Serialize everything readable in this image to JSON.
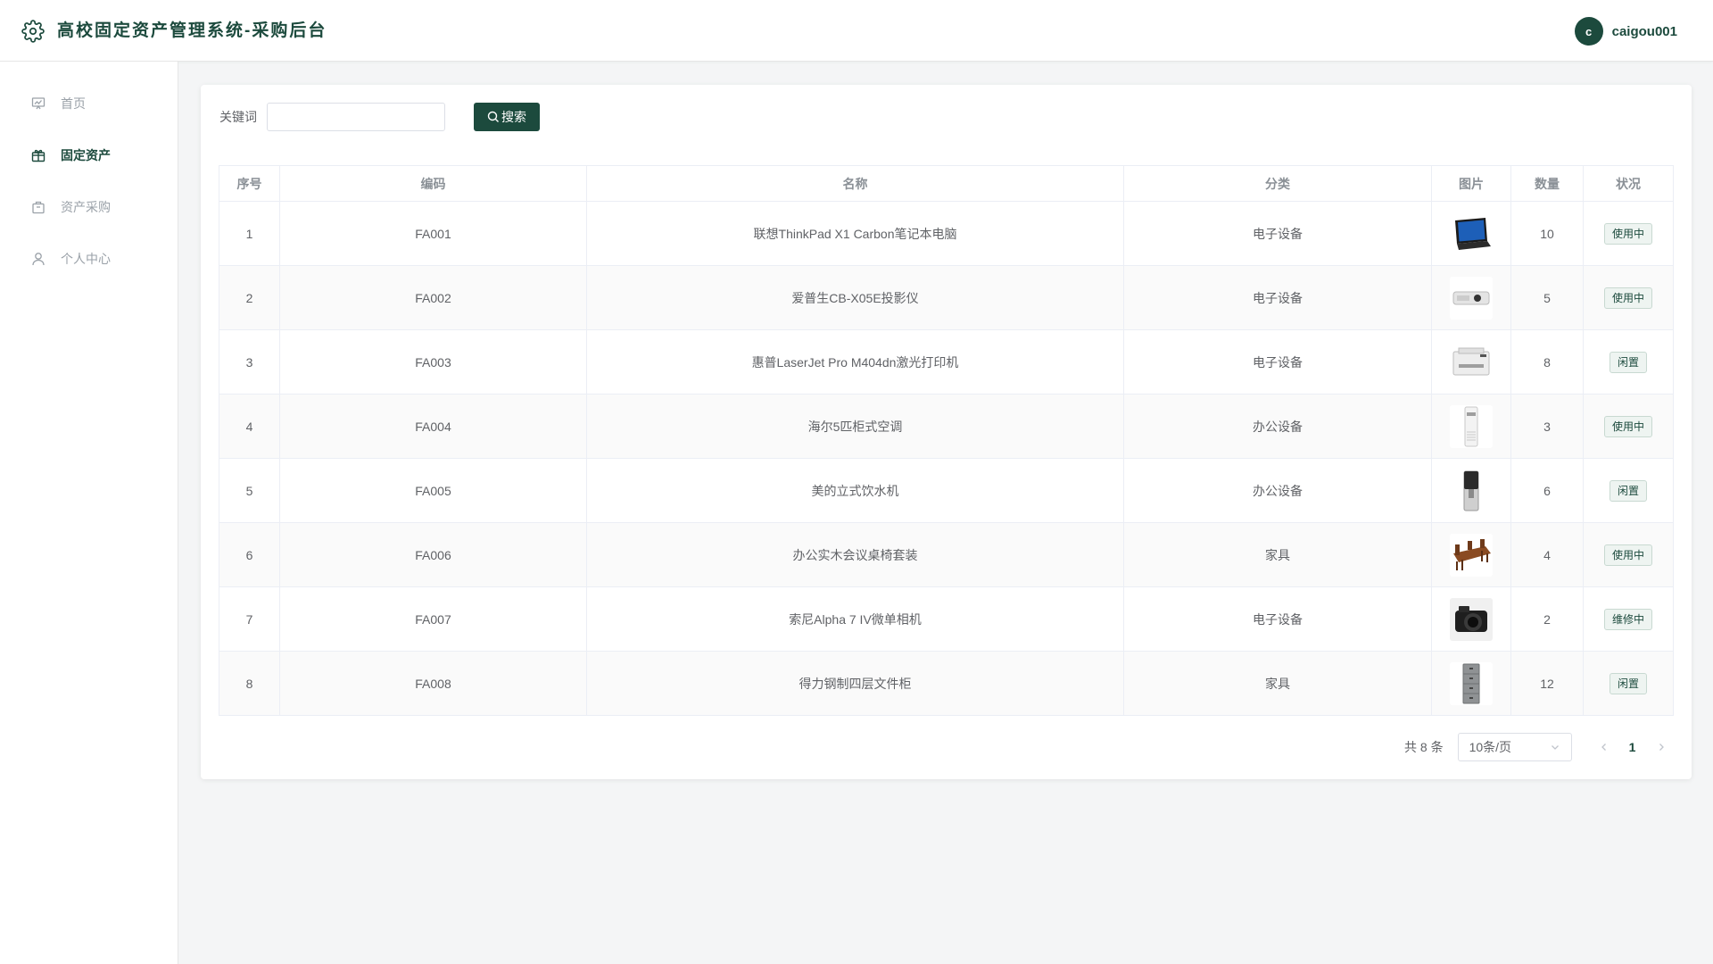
{
  "header": {
    "title": "高校固定资产管理系统-采购后台",
    "avatar_letter": "c",
    "username": "caigou001"
  },
  "sidebar": {
    "items": [
      {
        "label": "首页",
        "icon": "presentation-icon",
        "active": false
      },
      {
        "label": "固定资产",
        "icon": "gift-icon",
        "active": true
      },
      {
        "label": "资产采购",
        "icon": "briefcase-icon",
        "active": false
      },
      {
        "label": "个人中心",
        "icon": "user-icon",
        "active": false
      }
    ]
  },
  "search": {
    "label": "关键词",
    "value": "",
    "placeholder": "",
    "button": "搜索"
  },
  "table": {
    "columns": [
      "序号",
      "编码",
      "名称",
      "分类",
      "图片",
      "数量",
      "状况"
    ],
    "rows": [
      {
        "index": "1",
        "code": "FA001",
        "name": "联想ThinkPad X1 Carbon笔记本电脑",
        "category": "电子设备",
        "image": "laptop",
        "qty": "10",
        "status": "使用中"
      },
      {
        "index": "2",
        "code": "FA002",
        "name": "爱普生CB-X05E投影仪",
        "category": "电子设备",
        "image": "projector",
        "qty": "5",
        "status": "使用中"
      },
      {
        "index": "3",
        "code": "FA003",
        "name": "惠普LaserJet Pro M404dn激光打印机",
        "category": "电子设备",
        "image": "printer",
        "qty": "8",
        "status": "闲置"
      },
      {
        "index": "4",
        "code": "FA004",
        "name": "海尔5匹柜式空调",
        "category": "办公设备",
        "image": "air-conditioner",
        "qty": "3",
        "status": "使用中"
      },
      {
        "index": "5",
        "code": "FA005",
        "name": "美的立式饮水机",
        "category": "办公设备",
        "image": "water-dispenser",
        "qty": "6",
        "status": "闲置"
      },
      {
        "index": "6",
        "code": "FA006",
        "name": "办公实木会议桌椅套装",
        "category": "家具",
        "image": "conference-table",
        "qty": "4",
        "status": "使用中"
      },
      {
        "index": "7",
        "code": "FA007",
        "name": "索尼Alpha 7 IV微单相机",
        "category": "电子设备",
        "image": "camera",
        "qty": "2",
        "status": "维修中"
      },
      {
        "index": "8",
        "code": "FA008",
        "name": "得力钢制四层文件柜",
        "category": "家具",
        "image": "file-cabinet",
        "qty": "12",
        "status": "闲置"
      }
    ]
  },
  "pagination": {
    "total": "共 8 条",
    "page_size": "10条/页",
    "current": "1"
  },
  "colors": {
    "primary": "#1c4a3d",
    "background": "#f4f5f6",
    "border": "#ebeef5"
  }
}
